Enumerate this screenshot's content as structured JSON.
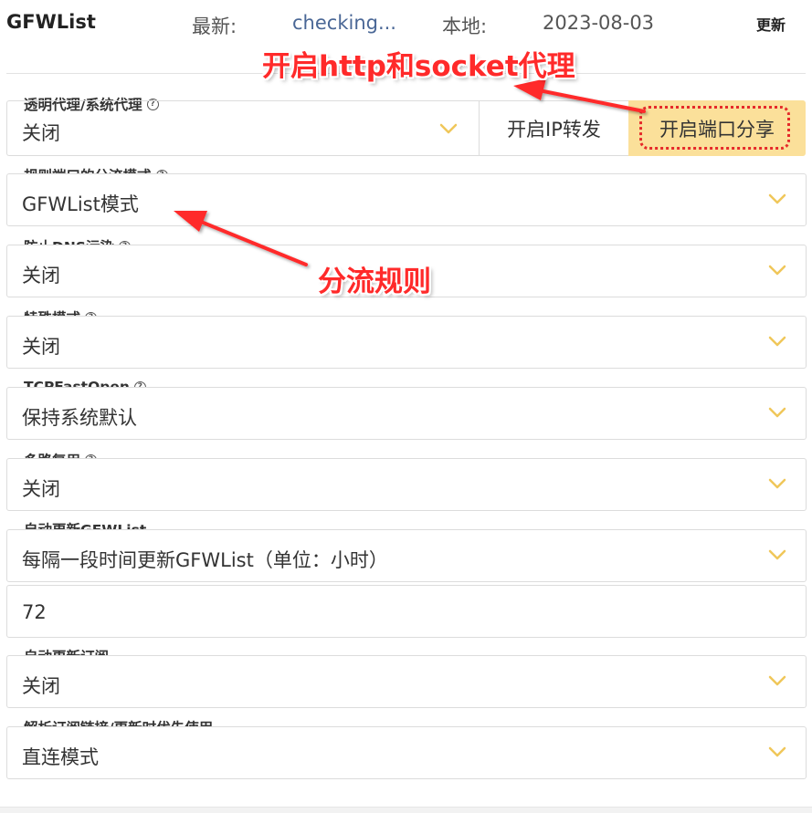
{
  "header": {
    "title": "GFWList",
    "latest_label": "最新:",
    "latest_value": "checking...",
    "local_label": "本地:",
    "local_value": "2023-08-03",
    "update_label": "更新"
  },
  "proxy_group": {
    "label": "透明代理/系统代理",
    "value": "关闭",
    "ip_forward_label": "开启IP转发",
    "port_share_label": "开启端口分享"
  },
  "settings": [
    {
      "label": "规则端口的分流模式",
      "value": "GFWList模式"
    },
    {
      "label": "防止DNS污染",
      "value": "关闭"
    },
    {
      "label": "特殊模式",
      "value": "关闭"
    },
    {
      "label": "TCPFastOpen",
      "value": "保持系统默认"
    },
    {
      "label": "多路复用",
      "value": "关闭"
    },
    {
      "label": "自动更新GFWList",
      "value": "每隔一段时间更新GFWList（单位：小时）",
      "extra_value": "72"
    },
    {
      "label": "自动更新订阅",
      "value": "关闭"
    },
    {
      "label": "解析订阅链接/更新时优先使用",
      "value": "直连模式"
    }
  ],
  "annotations": {
    "top_note": "开启http和socket代理",
    "mid_note": "分流规则"
  },
  "colors": {
    "accent": "#fbe09a",
    "chevron": "#f0c75a",
    "annotation": "#ff2a2a",
    "link": "#4a6796"
  }
}
